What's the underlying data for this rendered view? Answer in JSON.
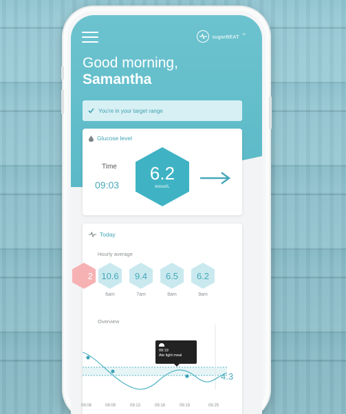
{
  "app": {
    "brand": "sugarBEAT",
    "brand_mark": "TM"
  },
  "header": {
    "greeting": "Good morning,",
    "user_name": "Samantha",
    "status_banner": "You're in your target range"
  },
  "glucose_card": {
    "title": "Glucose level",
    "time_label": "Time",
    "time_value": "09:03",
    "value": "6.2",
    "unit": "mmol/L",
    "trend": "steady"
  },
  "today_card": {
    "title": "Today",
    "hourly_label": "Hourly average",
    "hourly": [
      {
        "value": "2",
        "label": "",
        "status": "high"
      },
      {
        "value": "10.6",
        "label": "6am",
        "status": "normal"
      },
      {
        "value": "9.4",
        "label": "7am",
        "status": "normal"
      },
      {
        "value": "6.5",
        "label": "8am",
        "status": "normal"
      },
      {
        "value": "6.2",
        "label": "9am",
        "status": "normal"
      }
    ],
    "overview_label": "Overview"
  },
  "chart_data": {
    "type": "line",
    "x": [
      "09:06",
      "09:09",
      "09:13",
      "09:16",
      "09:19",
      "09:25"
    ],
    "current_value": "4.3",
    "annotation": {
      "time": "09:19",
      "text": "Ate light meal"
    }
  },
  "colors": {
    "brand": "#5bb9c7",
    "hex_primary": "#3fb3c4",
    "hex_light": "#c9e9ef",
    "high": "#f6b2b3"
  },
  "icons": {
    "menu": "hamburger-icon",
    "brand": "heartbeat-icon",
    "check": "check-icon",
    "drop": "drop-icon",
    "pulse": "pulse-icon",
    "arrow": "arrow-right-icon",
    "meal": "meal-icon"
  }
}
